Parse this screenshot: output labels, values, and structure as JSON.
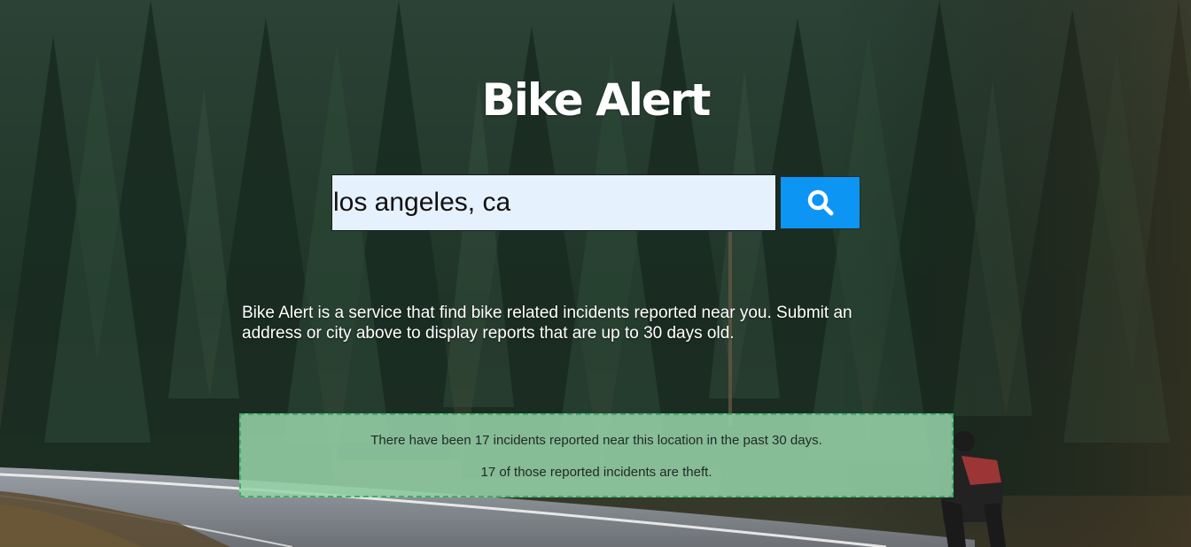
{
  "app": {
    "title": "Bike Alert"
  },
  "search": {
    "value": "los angeles, ca",
    "button_icon": "search-icon",
    "button_color": "#0d95f4",
    "input_background": "#e6f1fe"
  },
  "description": "Bike Alert is a service that find bike related incidents reported near you. Submit an address or city above to display reports that are up to 30 days old.",
  "results": {
    "total_message": "There have been 17 incidents reported near this location in the past 30 days.",
    "theft_message": "17 of those reported incidents are theft.",
    "panel_color": "#97d4aa",
    "border_color": "#3fae69"
  },
  "background": {
    "description_icon": "forest-road-photo",
    "colors": {
      "forest_dark": "#1f3328",
      "road": "#8f9398"
    }
  }
}
